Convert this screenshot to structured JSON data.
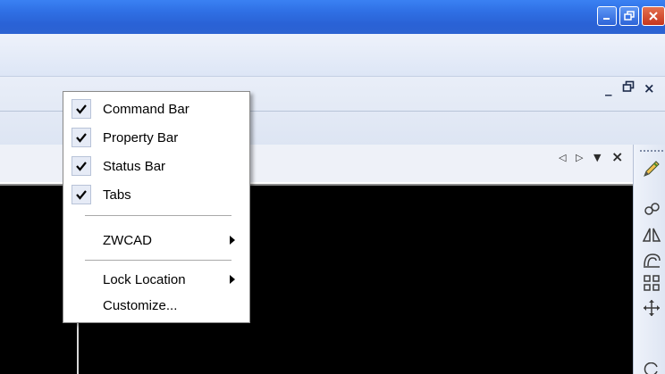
{
  "window": {
    "title_buttons": [
      "minimize-icon",
      "restore-icon",
      "close-icon"
    ],
    "accent_color": "#2a62d6",
    "close_color": "#c6361d"
  },
  "mdi_controls": {
    "minimize": "_",
    "restore": "❐",
    "close": "×"
  },
  "panel_controls": {
    "prev": "◁",
    "next": "▷",
    "menu": "▼",
    "close": "×"
  },
  "context_menu": {
    "items": [
      {
        "label": "Command Bar",
        "checked": true
      },
      {
        "label": "Property Bar",
        "checked": true
      },
      {
        "label": "Status Bar",
        "checked": true
      },
      {
        "label": "Tabs",
        "checked": true
      },
      {
        "label": "ZWCAD",
        "submenu": true
      },
      {
        "label": "Lock Location",
        "submenu": true
      },
      {
        "label": "Customize..."
      }
    ]
  },
  "right_toolbar": {
    "icons": [
      "pencil-icon",
      "copy-icon",
      "mirror-icon",
      "offset-icon",
      "array-icon",
      "move-icon",
      "rotate-icon"
    ]
  },
  "canvas_color": "#000000"
}
